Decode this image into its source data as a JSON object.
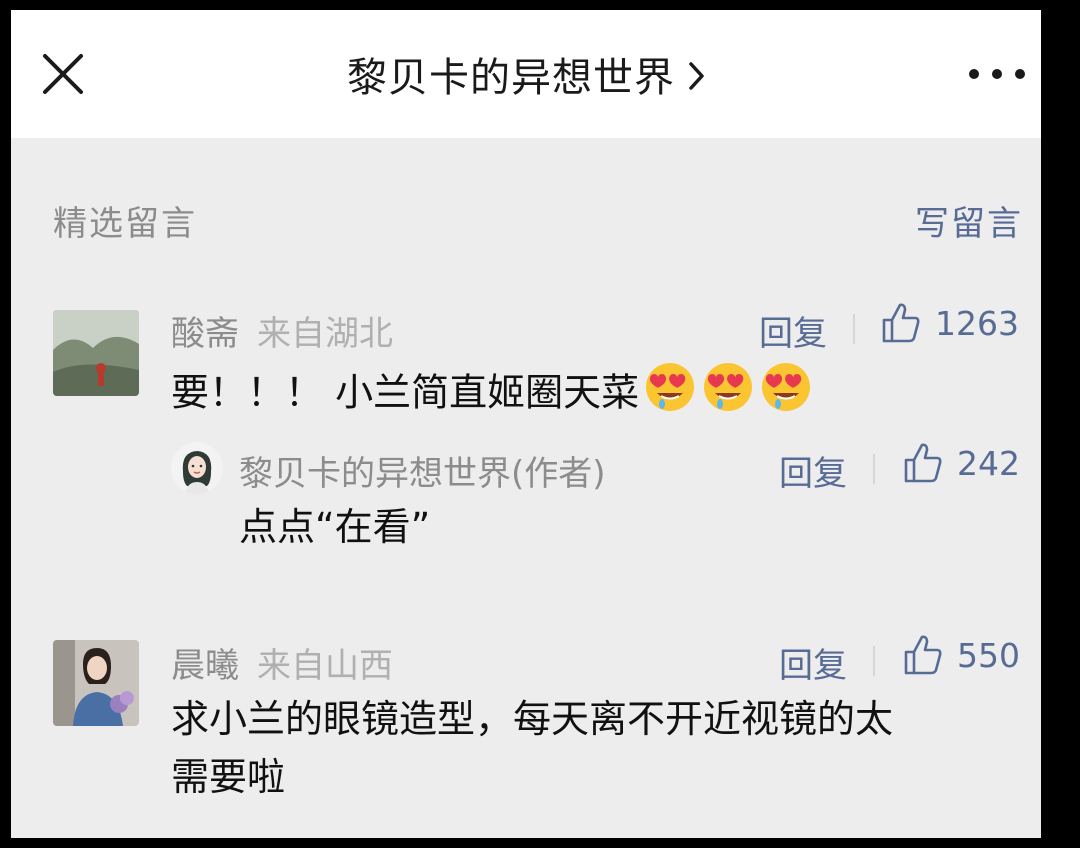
{
  "header": {
    "title": "黎贝卡的异想世界",
    "close_icon": "close-icon",
    "chevron_icon": "chevron-right-icon",
    "more_icon": "more-icon"
  },
  "section": {
    "label": "精选留言",
    "write_label": "写留言"
  },
  "comments": [
    {
      "name": "酸斋",
      "location": "来自湖北",
      "text": "要！！！ 小兰简直姬圈天菜",
      "emoji_count": 3,
      "emoji_icon": "heart-eyes-face-icon",
      "reply_label": "回复",
      "likes": "1263",
      "author_reply": {
        "name": "黎贝卡的异想世界(作者)",
        "text": "点点“在看”",
        "reply_label": "回复",
        "likes": "242"
      }
    },
    {
      "name": "晨曦",
      "location": "来自山西",
      "text_line1": "求小兰的眼镜造型，每天离不开近视镜的太",
      "text_line2": "需要啦",
      "reply_label": "回复",
      "likes": "550"
    }
  ],
  "colors": {
    "link": "#576b95",
    "muted": "#8c8c8c",
    "background": "#ededed"
  }
}
